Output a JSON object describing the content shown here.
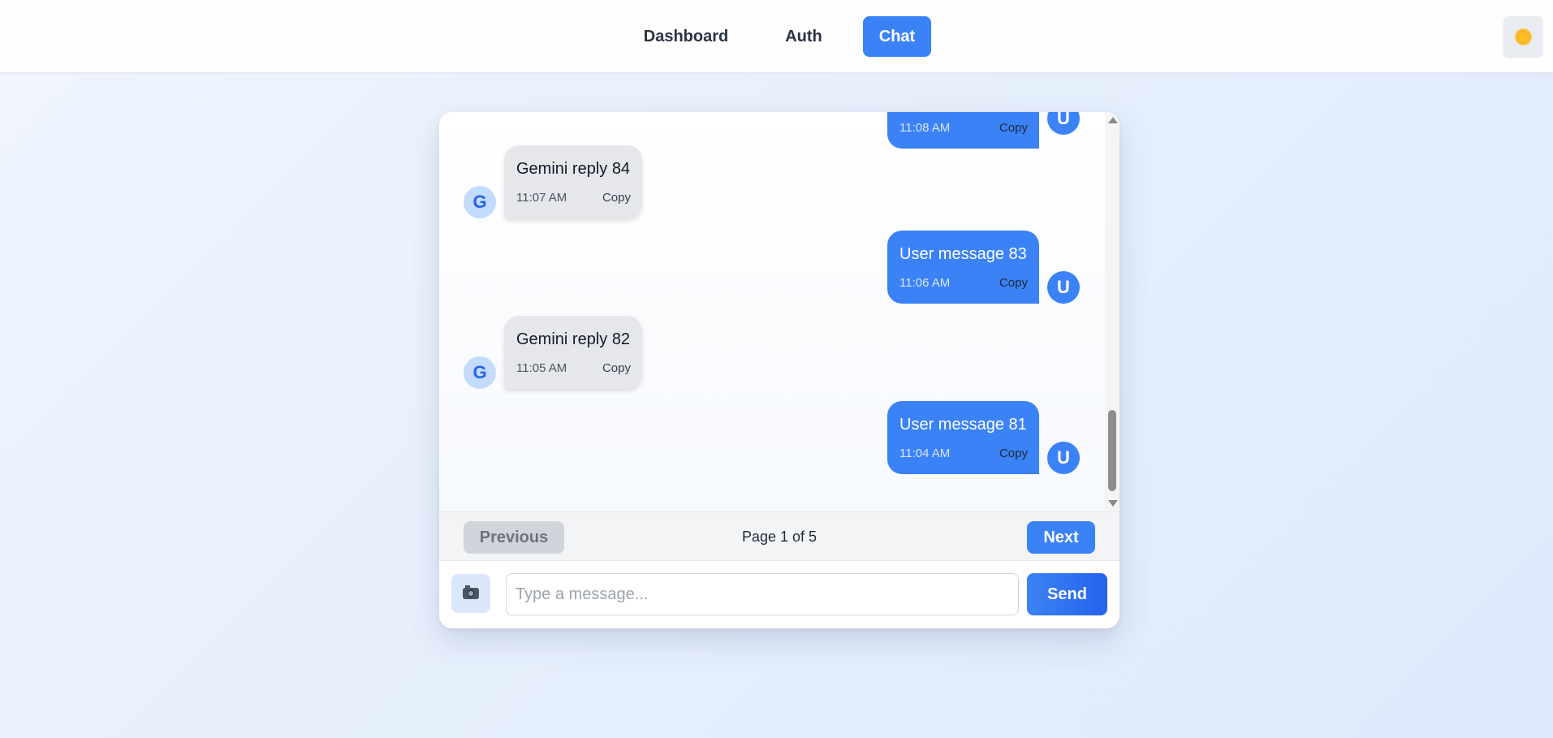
{
  "nav": {
    "links": [
      {
        "label": "Dashboard"
      },
      {
        "label": "Auth"
      },
      {
        "label": "Chat"
      }
    ],
    "theme_icon": "sun-icon"
  },
  "messages": [
    {
      "sender": "user",
      "avatar": "U",
      "text": "",
      "time": "11:08 AM",
      "copy": "Copy"
    },
    {
      "sender": "gemini",
      "avatar": "G",
      "text": "Gemini reply 84",
      "time": "11:07 AM",
      "copy": "Copy"
    },
    {
      "sender": "user",
      "avatar": "U",
      "text": "User message 83",
      "time": "11:06 AM",
      "copy": "Copy"
    },
    {
      "sender": "gemini",
      "avatar": "G",
      "text": "Gemini reply 82",
      "time": "11:05 AM",
      "copy": "Copy"
    },
    {
      "sender": "user",
      "avatar": "U",
      "text": "User message 81",
      "time": "11:04 AM",
      "copy": "Copy"
    }
  ],
  "pagination": {
    "previous_label": "Previous",
    "page_info": "Page 1 of 5",
    "next_label": "Next"
  },
  "composer": {
    "camera_icon": "camera-icon",
    "placeholder": "Type a message...",
    "value": "",
    "send_label": "Send"
  },
  "colors": {
    "accent": "#3b82f6",
    "gemini_bubble": "#e5e7eb",
    "gemini_avatar": "#c3dbfc"
  }
}
